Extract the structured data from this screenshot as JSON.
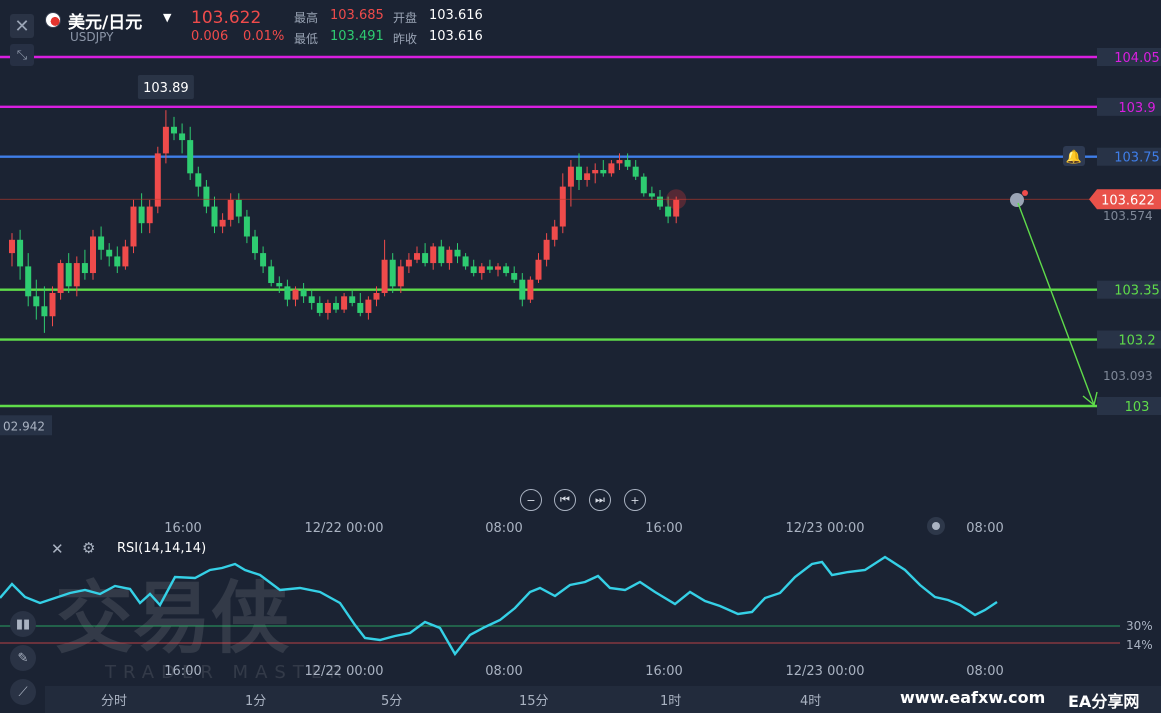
{
  "header": {
    "symbol_name": "美元/日元",
    "symbol_code": "USDJPY",
    "last_price": "103.622",
    "change": "0.006",
    "change_percent": "0.01%",
    "high_label": "最高",
    "high_value": "103.685",
    "low_label": "最低",
    "low_value": "103.491",
    "open_label": "开盘",
    "open_value": "103.616",
    "prev_close_label": "昨收",
    "prev_close_value": "103.616"
  },
  "colors": {
    "background": "#1b2333",
    "up": "#ef4b4b",
    "down": "#2ecc71",
    "magenta_line": "#d91ee0",
    "blue_line": "#3f7ee8",
    "green_line": "#5fdc4a",
    "rsi_line": "#35d0e6"
  },
  "price_levels": [
    {
      "price": "104.05",
      "color": "#d91ee0"
    },
    {
      "price": "103.9",
      "color": "#d91ee0"
    },
    {
      "price": "103.75",
      "color": "#3f7ee8"
    },
    {
      "price": "103.35",
      "color": "#5fdc4a"
    },
    {
      "price": "103.2",
      "color": "#5fdc4a"
    },
    {
      "price": "103",
      "color": "#5fdc4a"
    }
  ],
  "axis_labels": {
    "current_price_tag": "103.622",
    "upper_ref": "103.574",
    "lower_ref": "103.093",
    "left_edge_value": "02.942",
    "max_marker": "103.89"
  },
  "time_axis": [
    "16:00",
    "12/22 00:00",
    "08:00",
    "16:00",
    "12/23 00:00",
    "08:00"
  ],
  "rsi": {
    "label": "RSI(14,14,14)",
    "level_high": "30%",
    "level_low": "14%",
    "time_axis": [
      "16:00",
      "12/22 00:00",
      "08:00",
      "16:00",
      "12/23 00:00",
      "08:00"
    ]
  },
  "timeframes": [
    "分时",
    "1分",
    "5分",
    "15分",
    "1时",
    "4时"
  ],
  "watermark": {
    "cn": "交易侠",
    "en": "TRADER MASTER"
  },
  "footer_watermark": {
    "site": "www.eafxw.com",
    "name": "EA分享网"
  },
  "chart_data": {
    "type": "candlestick",
    "title": "美元/日元",
    "ylim": [
      102.94,
      104.1
    ],
    "candles": [
      [
        103.46,
        103.52,
        103.42,
        103.5
      ],
      [
        103.5,
        103.53,
        103.38,
        103.42
      ],
      [
        103.42,
        103.46,
        103.3,
        103.33
      ],
      [
        103.33,
        103.38,
        103.26,
        103.3
      ],
      [
        103.3,
        103.36,
        103.22,
        103.27
      ],
      [
        103.27,
        103.36,
        103.24,
        103.34
      ],
      [
        103.34,
        103.44,
        103.32,
        103.43
      ],
      [
        103.43,
        103.46,
        103.34,
        103.36
      ],
      [
        103.36,
        103.45,
        103.33,
        103.43
      ],
      [
        103.43,
        103.47,
        103.38,
        103.4
      ],
      [
        103.4,
        103.53,
        103.38,
        103.51
      ],
      [
        103.51,
        103.54,
        103.44,
        103.47
      ],
      [
        103.47,
        103.49,
        103.42,
        103.45
      ],
      [
        103.45,
        103.48,
        103.4,
        103.42
      ],
      [
        103.42,
        103.5,
        103.41,
        103.48
      ],
      [
        103.48,
        103.62,
        103.46,
        103.6
      ],
      [
        103.6,
        103.64,
        103.52,
        103.55
      ],
      [
        103.55,
        103.62,
        103.52,
        103.6
      ],
      [
        103.6,
        103.78,
        103.58,
        103.76
      ],
      [
        103.76,
        103.89,
        103.73,
        103.84
      ],
      [
        103.84,
        103.87,
        103.8,
        103.82
      ],
      [
        103.82,
        103.85,
        103.76,
        103.8
      ],
      [
        103.8,
        103.84,
        103.68,
        103.7
      ],
      [
        103.7,
        103.72,
        103.63,
        103.66
      ],
      [
        103.66,
        103.68,
        103.58,
        103.6
      ],
      [
        103.6,
        103.63,
        103.52,
        103.54
      ],
      [
        103.54,
        103.58,
        103.52,
        103.56
      ],
      [
        103.56,
        103.64,
        103.54,
        103.62
      ],
      [
        103.62,
        103.64,
        103.55,
        103.57
      ],
      [
        103.57,
        103.59,
        103.49,
        103.51
      ],
      [
        103.51,
        103.53,
        103.44,
        103.46
      ],
      [
        103.46,
        103.48,
        103.4,
        103.42
      ],
      [
        103.42,
        103.44,
        103.36,
        103.37
      ],
      [
        103.37,
        103.39,
        103.34,
        103.36
      ],
      [
        103.36,
        103.38,
        103.3,
        103.32
      ],
      [
        103.32,
        103.36,
        103.3,
        103.35
      ],
      [
        103.35,
        103.37,
        103.31,
        103.33
      ],
      [
        103.33,
        103.35,
        103.29,
        103.31
      ],
      [
        103.31,
        103.33,
        103.27,
        103.28
      ],
      [
        103.28,
        103.32,
        103.26,
        103.31
      ],
      [
        103.31,
        103.33,
        103.28,
        103.29
      ],
      [
        103.29,
        103.34,
        103.28,
        103.33
      ],
      [
        103.33,
        103.35,
        103.3,
        103.31
      ],
      [
        103.31,
        103.34,
        103.27,
        103.28
      ],
      [
        103.28,
        103.33,
        103.26,
        103.32
      ],
      [
        103.32,
        103.36,
        103.3,
        103.34
      ],
      [
        103.34,
        103.5,
        103.33,
        103.44
      ],
      [
        103.44,
        103.46,
        103.34,
        103.36
      ],
      [
        103.36,
        103.44,
        103.34,
        103.42
      ],
      [
        103.42,
        103.46,
        103.4,
        103.44
      ],
      [
        103.44,
        103.48,
        103.43,
        103.46
      ],
      [
        103.46,
        103.49,
        103.42,
        103.43
      ],
      [
        103.43,
        103.49,
        103.41,
        103.48
      ],
      [
        103.48,
        103.5,
        103.42,
        103.43
      ],
      [
        103.43,
        103.48,
        103.41,
        103.47
      ],
      [
        103.47,
        103.49,
        103.43,
        103.45
      ],
      [
        103.45,
        103.46,
        103.41,
        103.42
      ],
      [
        103.42,
        103.44,
        103.39,
        103.4
      ],
      [
        103.4,
        103.43,
        103.38,
        103.42
      ],
      [
        103.42,
        103.44,
        103.4,
        103.41
      ],
      [
        103.41,
        103.43,
        103.39,
        103.42
      ],
      [
        103.42,
        103.43,
        103.39,
        103.4
      ],
      [
        103.4,
        103.42,
        103.37,
        103.38
      ],
      [
        103.38,
        103.4,
        103.3,
        103.32
      ],
      [
        103.32,
        103.39,
        103.31,
        103.38
      ],
      [
        103.38,
        103.46,
        103.37,
        103.44
      ],
      [
        103.44,
        103.52,
        103.42,
        103.5
      ],
      [
        103.5,
        103.56,
        103.48,
        103.54
      ],
      [
        103.54,
        103.7,
        103.52,
        103.66
      ],
      [
        103.66,
        103.74,
        103.6,
        103.72
      ],
      [
        103.72,
        103.76,
        103.65,
        103.68
      ],
      [
        103.68,
        103.72,
        103.66,
        103.7
      ],
      [
        103.7,
        103.73,
        103.67,
        103.71
      ],
      [
        103.71,
        103.74,
        103.69,
        103.7
      ],
      [
        103.7,
        103.74,
        103.69,
        103.73
      ],
      [
        103.73,
        103.76,
        103.71,
        103.74
      ],
      [
        103.74,
        103.76,
        103.71,
        103.72
      ],
      [
        103.72,
        103.74,
        103.68,
        103.69
      ],
      [
        103.69,
        103.7,
        103.63,
        103.64
      ],
      [
        103.64,
        103.66,
        103.62,
        103.63
      ],
      [
        103.63,
        103.65,
        103.59,
        103.6
      ],
      [
        103.6,
        103.63,
        103.55,
        103.57
      ],
      [
        103.57,
        103.63,
        103.55,
        103.62
      ]
    ]
  }
}
